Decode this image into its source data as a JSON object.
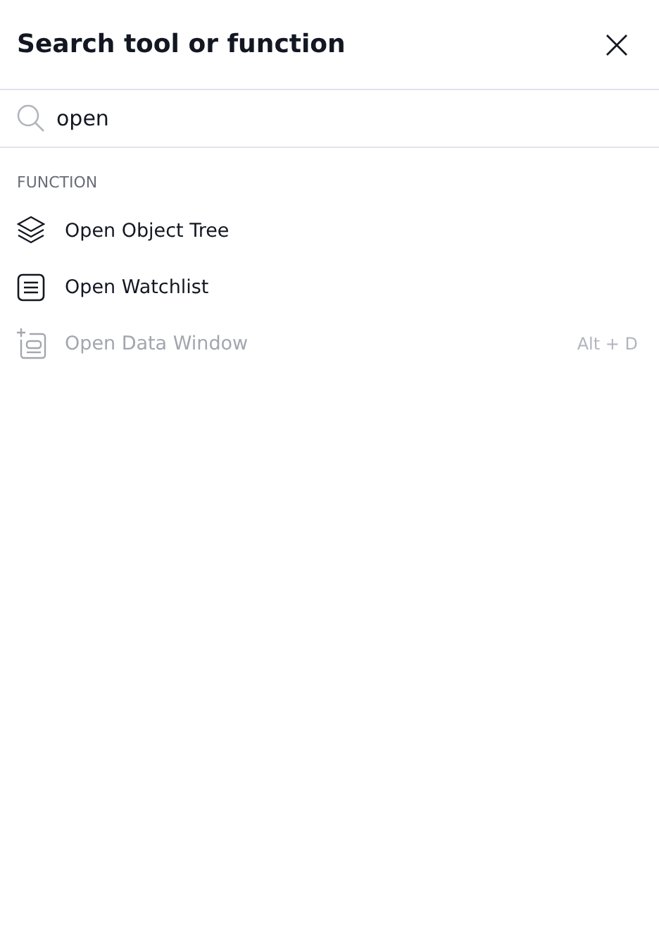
{
  "dialog": {
    "title": "Search tool or function"
  },
  "search": {
    "value": "open"
  },
  "sections": [
    {
      "heading": "FUNCTION",
      "items": [
        {
          "kind": "layers",
          "label": "Open Object Tree",
          "disabled": false
        },
        {
          "kind": "list",
          "label": "Open Watchlist",
          "disabled": false
        },
        {
          "kind": "data-window",
          "label": "Open Data Window",
          "disabled": true,
          "shortcut": "Alt + D"
        }
      ]
    }
  ]
}
